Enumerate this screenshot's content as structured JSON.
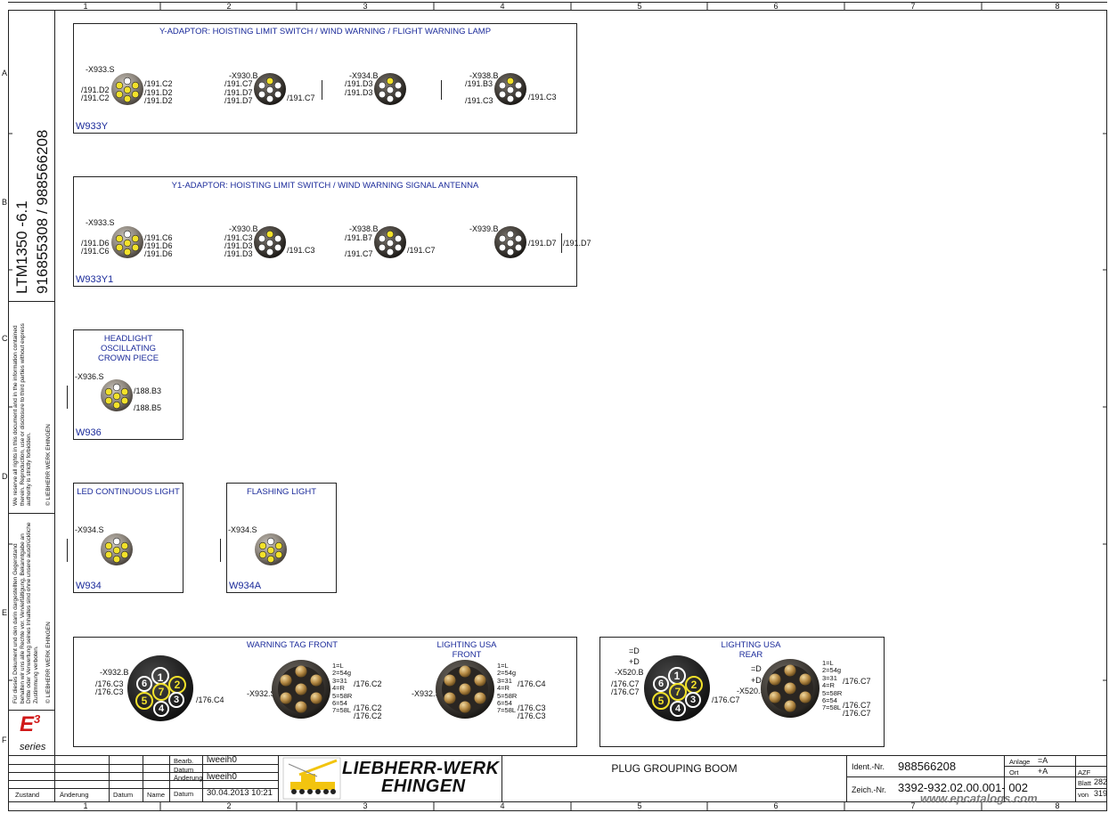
{
  "frame": {
    "columns": [
      "1",
      "2",
      "3",
      "4",
      "5",
      "6",
      "7",
      "8"
    ],
    "rows": [
      "A",
      "B",
      "C",
      "D",
      "E",
      "F"
    ]
  },
  "side": {
    "model": "LTM1350 -6.1",
    "numbers": "916855308  /  988566208",
    "legal_en": "We reserve all rights in this document and in the information contained therein. Reproduction, use or disclosure to third parties without express authority is strictly forbidden.",
    "copyright_en": "© LIEBHERR WERK EHINGEN",
    "legal_de": "Für dieses Dokument und den darin dargestellten Gegenstand behalten wir uns alle Rechte vor. Vervielfältigung, Bekanntgabe an Dritte oder Verwertung seines Inhaltes sind ohne unsere ausdrückliche Zustimmung verboten.",
    "copyright_de": "© LIEBHERR WERK EHINGEN",
    "e3_logo": "E",
    "e3_sup": "3",
    "e3_series": "series"
  },
  "panels": {
    "w933y": {
      "title": "Y-ADAPTOR: HOISTING LIMIT SWITCH / WIND WARNING / FLIGHT WARNING LAMP",
      "id": "W933Y",
      "c1": {
        "name": "-X933.S",
        "left": [
          "/191.D2",
          "/191.C2"
        ],
        "right": [
          "/191.C2",
          "/191.D2",
          "/191.D2"
        ]
      },
      "c2": {
        "name": "-X930.B",
        "left": [
          "/191.C7",
          "/191.D7",
          "/191.D7"
        ],
        "right": "/191.C7"
      },
      "c3": {
        "name": "-X934.B",
        "left": [
          "/191.D3",
          "/191.D3"
        ]
      },
      "c4": {
        "name": "-X938.B",
        "left": [
          "/191.B3",
          "/191.C3"
        ],
        "right": "/191.C3"
      }
    },
    "w933y1": {
      "title": "Y1-ADAPTOR: HOISTING LIMIT SWITCH / WIND WARNING SIGNAL ANTENNA",
      "id": "W933Y1",
      "c1": {
        "name": "-X933.S",
        "left": [
          "/191.D6",
          "/191.C6"
        ],
        "right": [
          "/191.C6",
          "/191.D6",
          "/191.D6"
        ]
      },
      "c2": {
        "name": "-X930.B",
        "left": [
          "/191.C3",
          "/191.D3",
          "/191.D3"
        ],
        "right": "/191.C3"
      },
      "c3": {
        "name": "-X938.B",
        "left": [
          "/191.B7",
          "/191.C7"
        ],
        "right": "/191.C7"
      },
      "c4": {
        "name": "-X939.B",
        "right": [
          "/191.D7",
          "/191.D7"
        ]
      }
    },
    "w936": {
      "title": [
        "HEADLIGHT",
        "OSCILLATING",
        "CROWN PIECE"
      ],
      "id": "W936",
      "name": "-X936.S",
      "right": [
        "/188.B3",
        "/188.B5"
      ]
    },
    "w934": {
      "title": "LED CONTINUOUS LIGHT",
      "id": "W934",
      "name": "-X934.S"
    },
    "w934a": {
      "title": "FLASHING LIGHT",
      "id": "W934A",
      "name": "-X934.S"
    },
    "warning": {
      "title_front": "WARNING TAG FRONT",
      "title_usa": [
        "LIGHTING USA",
        "FRONT"
      ],
      "big_name": "-X932.B",
      "big_left": [
        "/176.C3",
        "/176.C3"
      ],
      "big_right": "/176.C4",
      "big_pins": [
        "1",
        "2",
        "3",
        "4",
        "5",
        "6",
        "7"
      ],
      "s1_name": "-X932.S",
      "s2_name": "-X932.S",
      "legend": [
        "1=L",
        "2=54g",
        "3=31",
        "4=R",
        "5=58R",
        "6=54",
        "7=58L"
      ],
      "s1_refs": [
        "/176.C2",
        "/176.C2",
        "/176.C2"
      ],
      "s2_refs": [
        "/176.C4",
        "/176.C3",
        "/176.C3"
      ]
    },
    "rear": {
      "title": [
        "LIGHTING USA",
        "REAR"
      ],
      "eq1": [
        "=D",
        "+D"
      ],
      "big_name": "-X520.B",
      "big_left": [
        "/176.C7",
        "/176.C7"
      ],
      "big_right": "/176.C7",
      "eq2": [
        "=D",
        "+D"
      ],
      "s_name": "-X520.S",
      "legend": [
        "1=L",
        "2=54g",
        "3=31",
        "4=R",
        "5=58R",
        "6=54",
        "7=58L"
      ],
      "s_refs": [
        "/176.C7",
        "/176.C7",
        "/176.C7"
      ]
    }
  },
  "title_block": {
    "bearb_label": "Bearb.",
    "bearb_value": "lweeih0",
    "datum_label": "Datum",
    "aenderung_label": "Änderung",
    "aenderung_value": "lweeih0",
    "datum_value": "30.04.2013  10:21",
    "zustand": "Zustand",
    "aend": "Änderung",
    "datum2": "Datum",
    "name": "Name",
    "datum3": "Datum",
    "company_line1": "LIEBHERR-WERK",
    "company_line2": "EHINGEN",
    "drawing_title": "PLUG GROUPING BOOM",
    "ident_label": "Ident.-Nr.",
    "ident_value": "988566208",
    "zeich_label": "Zeich.-Nr.",
    "zeich_value": "3392-932.02.00.001- 002",
    "anlage_label": "Anlage",
    "anlage_value": "=A",
    "ort_label": "Ort",
    "ort_value": "+A",
    "azf": "AZF",
    "blatt_label": "Blatt",
    "blatt_value": "282",
    "von_label": "von",
    "von_value": "319"
  },
  "watermark": "www.epcatalogs.com",
  "colors": {
    "title_blue": "#1a2a9a",
    "pin_yellow": "#f2e12a",
    "connector_grey": "#8f8a84"
  }
}
